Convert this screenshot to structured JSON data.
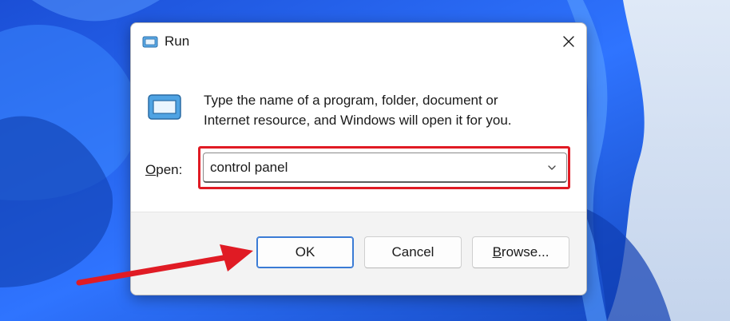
{
  "dialog": {
    "title": "Run",
    "description_line1": "Type the name of a program, folder, document or",
    "description_line2": "Internet resource, and Windows will open it for you.",
    "open_label_prefix": "",
    "open_label_accel": "O",
    "open_label_rest": "pen:",
    "open_value": "control panel",
    "buttons": {
      "ok": "OK",
      "cancel": "Cancel",
      "browse_accel": "B",
      "browse_rest": "rowse..."
    }
  },
  "icons": {
    "title": "run-icon",
    "close": "close-icon",
    "large": "run-icon",
    "dropdown": "chevron-down-icon",
    "annotation_arrow": "red-arrow-icon"
  },
  "colors": {
    "highlight_border": "#e01b24",
    "annotation_arrow": "#e01b24",
    "ok_button_border": "#3a7bd5",
    "wallpaper_blue": "#1f5fe0"
  }
}
